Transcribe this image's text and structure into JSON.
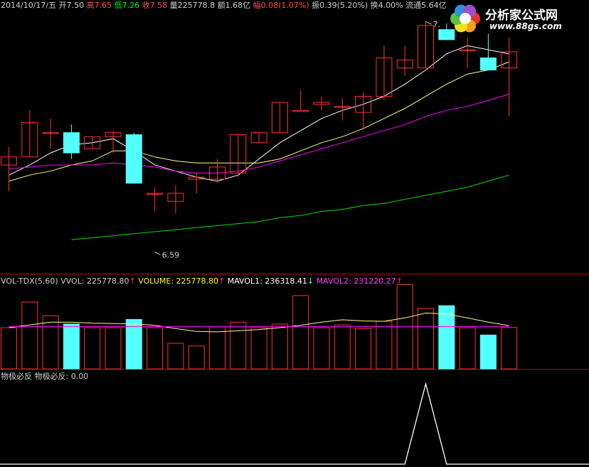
{
  "header": {
    "date": "2014/10/17/五",
    "open_label": "开",
    "open_value": "7.50",
    "high_label": "高",
    "high_value": "7.65",
    "low_label": "低",
    "low_value": "7.26",
    "close_label": "收",
    "close_value": "7.58",
    "volume_label": "量",
    "volume_value": "225778.8",
    "amount_label": "额",
    "amount_value": "1.68亿",
    "change_label": "幅",
    "change_value": "0.08(1.07%)",
    "amplitude_label": "振",
    "amplitude_value": "0.39(5.20%)",
    "turnover_label": "换",
    "turnover_value": "4.00%",
    "float_label": "流通",
    "float_value": "5.64亿"
  },
  "volume_header": {
    "name": "VOL-TDX(5,60)",
    "vvol": "VVOL: 225778.80",
    "volume": "VOLUME: 225778.80",
    "mavol1": "MAVOL1: 236318.41",
    "mavol2": "MAVOL2: 231220.27"
  },
  "signal_header": {
    "name": "物极必反",
    "value": "物极必反: 0.00"
  },
  "logo": {
    "text": "分析家公式网",
    "url": "www.88gs.com",
    "petal_colors": [
      "#e8322a",
      "#f7a21b",
      "#f6e21a",
      "#5cc23a",
      "#2f8fe0",
      "#9b4fd1"
    ]
  },
  "colors": {
    "up": "#ff3232",
    "down": "#54ffff",
    "ma_white": "#ffffff",
    "ma_yellow": "#ffff80",
    "ma_magenta": "#ff00ff",
    "ma_green": "#00e000",
    "label_white": "#d0d0d0",
    "label_red": "#ff5050",
    "label_green": "#00ff00",
    "label_yellow": "#ffff00",
    "label_magenta": "#ff40ff",
    "label_cyan": "#54ffff",
    "signal_line": "#ffffff"
  },
  "chart_data": [
    {
      "type": "candlestick",
      "y_range": [
        6.5,
        7.78
      ],
      "annotations": [
        {
          "text": "6.59",
          "index": 7,
          "value": 6.59
        },
        {
          "text": "7.",
          "index": 20,
          "value": 7.73
        }
      ],
      "candles": [
        {
          "o": 7.02,
          "h": 7.11,
          "l": 6.89,
          "c": 7.06
        },
        {
          "o": 7.06,
          "h": 7.29,
          "l": 7.06,
          "c": 7.23
        },
        {
          "o": 7.18,
          "h": 7.25,
          "l": 7.1,
          "c": 7.18
        },
        {
          "o": 7.18,
          "h": 7.22,
          "l": 7.05,
          "c": 7.08
        },
        {
          "o": 7.1,
          "h": 7.16,
          "l": 7.1,
          "c": 7.16
        },
        {
          "o": 7.16,
          "h": 7.19,
          "l": 7.08,
          "c": 7.18
        },
        {
          "o": 7.17,
          "h": 7.18,
          "l": 6.93,
          "c": 6.93
        },
        {
          "o": 6.88,
          "h": 6.91,
          "l": 6.79,
          "c": 6.88
        },
        {
          "o": 6.84,
          "h": 6.92,
          "l": 6.78,
          "c": 6.88
        },
        {
          "o": 6.95,
          "h": 6.98,
          "l": 6.88,
          "c": 6.96
        },
        {
          "o": 6.95,
          "h": 7.05,
          "l": 6.93,
          "c": 7.01
        },
        {
          "o": 6.98,
          "h": 7.17,
          "l": 6.96,
          "c": 7.17
        },
        {
          "o": 7.13,
          "h": 7.18,
          "l": 7.13,
          "c": 7.18
        },
        {
          "o": 7.18,
          "h": 7.33,
          "l": 7.18,
          "c": 7.33
        },
        {
          "o": 7.29,
          "h": 7.39,
          "l": 7.29,
          "c": 7.29
        },
        {
          "o": 7.32,
          "h": 7.36,
          "l": 7.29,
          "c": 7.33
        },
        {
          "o": 7.31,
          "h": 7.35,
          "l": 7.24,
          "c": 7.31
        },
        {
          "o": 7.28,
          "h": 7.38,
          "l": 7.2,
          "c": 7.36
        },
        {
          "o": 7.36,
          "h": 7.61,
          "l": 7.34,
          "c": 7.55
        },
        {
          "o": 7.5,
          "h": 7.61,
          "l": 7.46,
          "c": 7.54
        },
        {
          "o": 7.5,
          "h": 7.73,
          "l": 7.5,
          "c": 7.71
        },
        {
          "o": 7.69,
          "h": 7.72,
          "l": 7.64,
          "c": 7.64
        },
        {
          "o": 7.59,
          "h": 7.65,
          "l": 7.5,
          "c": 7.59
        },
        {
          "o": 7.55,
          "h": 7.67,
          "l": 7.49,
          "c": 7.49
        },
        {
          "o": 7.5,
          "h": 7.65,
          "l": 7.26,
          "c": 7.58
        }
      ],
      "ma": [
        {
          "color": "ma_white",
          "values": [
            6.97,
            7.02,
            7.08,
            7.12,
            7.13,
            7.15,
            7.09,
            7.02,
            6.99,
            6.96,
            6.94,
            6.97,
            7.05,
            7.13,
            7.19,
            7.25,
            7.29,
            7.32,
            7.36,
            7.42,
            7.49,
            7.57,
            7.61,
            7.59,
            7.57
          ]
        },
        {
          "color": "ma_yellow",
          "values": [
            6.94,
            6.97,
            6.99,
            7.02,
            7.04,
            7.09,
            7.09,
            7.06,
            7.04,
            7.03,
            7.03,
            7.03,
            7.03,
            7.05,
            7.09,
            7.13,
            7.16,
            7.2,
            7.25,
            7.3,
            7.36,
            7.42,
            7.47,
            7.49,
            7.53
          ]
        },
        {
          "color": "ma_magenta",
          "values": [
            7.0,
            7.01,
            7.02,
            7.02,
            7.02,
            7.03,
            7.02,
            7.01,
            6.99,
            6.98,
            6.98,
            6.99,
            7.01,
            7.04,
            7.07,
            7.1,
            7.13,
            7.16,
            7.19,
            7.22,
            7.26,
            7.29,
            7.31,
            7.34,
            7.37
          ]
        },
        {
          "color": "ma_green",
          "start": 3,
          "values": [
            6.65,
            6.66,
            6.67,
            6.68,
            6.69,
            6.7,
            6.71,
            6.72,
            6.73,
            6.74,
            6.76,
            6.77,
            6.79,
            6.8,
            6.82,
            6.83,
            6.85,
            6.87,
            6.89,
            6.91,
            6.94,
            6.97
          ]
        }
      ]
    },
    {
      "type": "bar",
      "name": "VOL-TDX(5,60)",
      "y_range": [
        0,
        450000
      ],
      "values": [
        225000,
        365000,
        290000,
        245000,
        225000,
        225000,
        270000,
        225000,
        140000,
        125000,
        230000,
        255000,
        225000,
        245000,
        400000,
        225000,
        240000,
        220000,
        260000,
        460000,
        330000,
        345000,
        225000,
        185000,
        225778.8
      ],
      "mavol1": [
        225000,
        240000,
        255000,
        255000,
        250000,
        248000,
        245000,
        238000,
        220000,
        205000,
        202000,
        208000,
        215000,
        225000,
        238000,
        255000,
        268000,
        262000,
        260000,
        278000,
        305000,
        300000,
        278000,
        255000,
        236318.41
      ],
      "mavol2": [
        231000,
        231000,
        231000,
        231000,
        231000,
        231000,
        231000,
        231000,
        231000,
        231000,
        231000,
        231000,
        231000,
        231000,
        231000,
        231000,
        231000,
        231000,
        231000,
        231000,
        231000,
        231000,
        231000,
        231000,
        231220.27
      ]
    },
    {
      "type": "line",
      "name": "物极必反",
      "y_range": [
        0,
        1
      ],
      "values": [
        0,
        0,
        0,
        0,
        0,
        0,
        0,
        0,
        0,
        0,
        0,
        0,
        0,
        0,
        0,
        0,
        0,
        0,
        0,
        0,
        1,
        0,
        0,
        0,
        0
      ]
    }
  ]
}
